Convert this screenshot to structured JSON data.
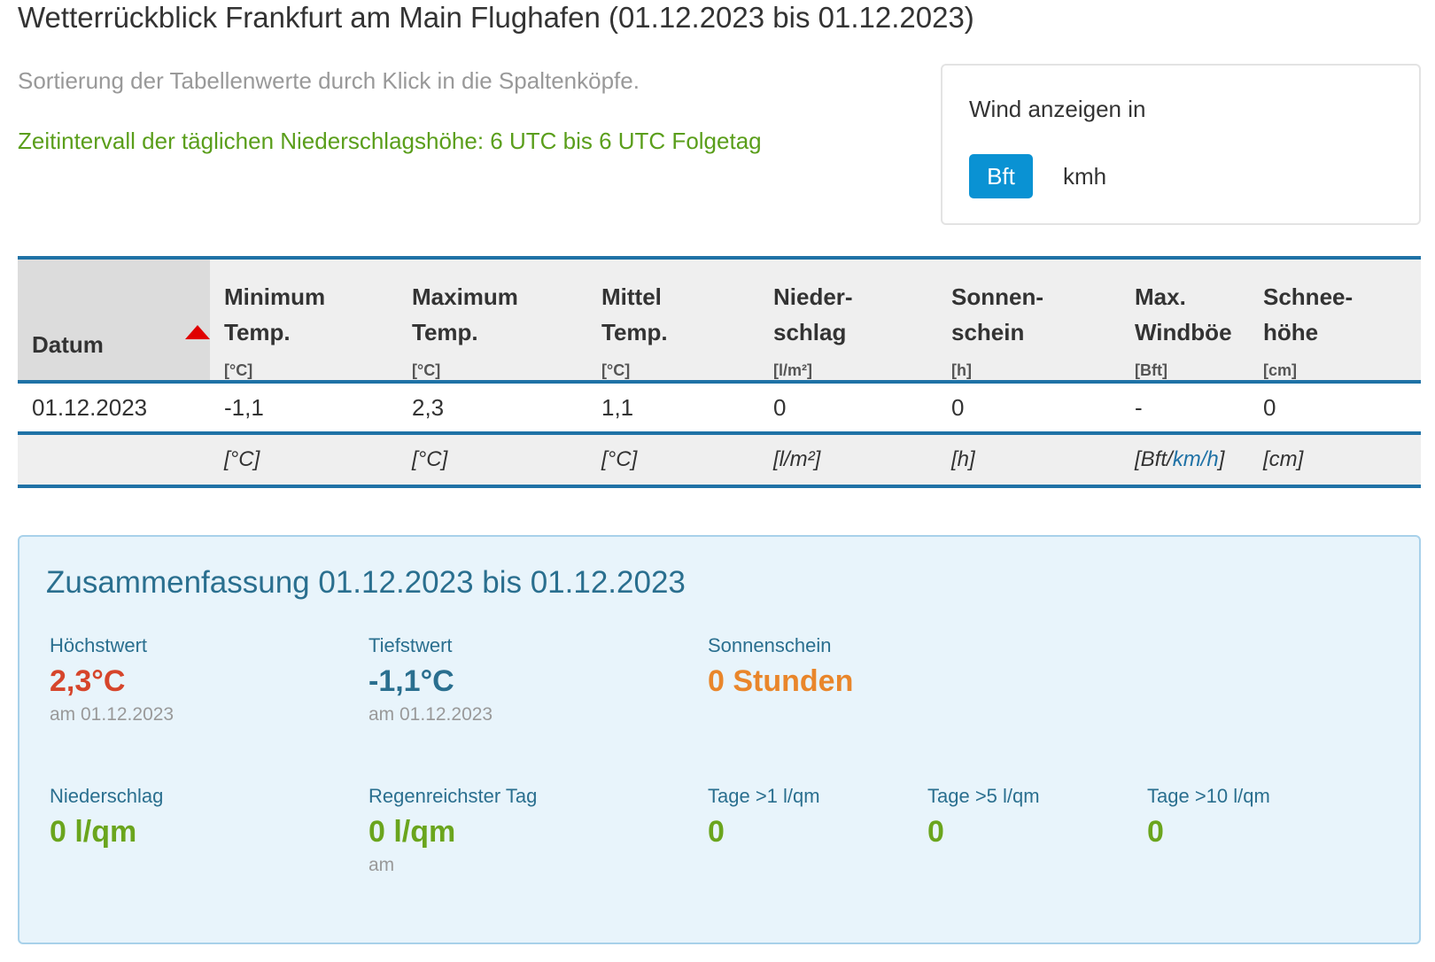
{
  "page": {
    "title": "Wetterrückblick Frankfurt am Main Flughafen (01.12.2023 bis 01.12.2023)",
    "sort_hint": "Sortierung der Tabellenwerte durch Klick in die Spaltenköpfe.",
    "interval_note": "Zeitintervall der täglichen Niederschlagshöhe: 6 UTC bis 6 UTC Folgetag"
  },
  "wind_toggle": {
    "label": "Wind anzeigen in",
    "options": [
      "Bft",
      "kmh"
    ],
    "selected": "Bft"
  },
  "table": {
    "columns": [
      {
        "name": "Datum",
        "unit": ""
      },
      {
        "name_line1": "Minimum",
        "name_line2": "Temp.",
        "unit": "[°C]"
      },
      {
        "name_line1": "Maximum",
        "name_line2": "Temp.",
        "unit": "[°C]"
      },
      {
        "name_line1": "Mittel",
        "name_line2": "Temp.",
        "unit": "[°C]"
      },
      {
        "name_line1": "Nieder-",
        "name_line2": "schlag",
        "unit": "[l/m²]"
      },
      {
        "name_line1": "Sonnen-",
        "name_line2": "schein",
        "unit": "[h]"
      },
      {
        "name_line1": "Max.",
        "name_line2": "Windböe",
        "unit": "[Bft]"
      },
      {
        "name_line1": "Schnee-",
        "name_line2": "höhe",
        "unit": "[cm]"
      }
    ],
    "rows": [
      [
        "01.12.2023",
        "-1,1",
        "2,3",
        "1,1",
        "0",
        "0",
        "-",
        "0"
      ]
    ],
    "footer_units": [
      "",
      "[°C]",
      "[°C]",
      "[°C]",
      "[l/m²]",
      "[h]",
      "",
      "[cm]"
    ],
    "footer_wind": {
      "pre": "[Bft/",
      "link": "km/h",
      "post": "]"
    }
  },
  "summary": {
    "title": "Zusammenfassung 01.12.2023 bis 01.12.2023",
    "hoechstwert": {
      "label": "Höchstwert",
      "value": "2,3°C",
      "sub": "am 01.12.2023"
    },
    "tiefstwert": {
      "label": "Tiefstwert",
      "value": "-1,1°C",
      "sub": "am 01.12.2023"
    },
    "sonnenschein": {
      "label": "Sonnenschein",
      "value": "0 Stunden"
    },
    "niederschlag": {
      "label": "Niederschlag",
      "value": "0 l/qm"
    },
    "regenreichster": {
      "label": "Regenreichster Tag",
      "value": "0 l/qm",
      "sub": "am"
    },
    "tage1": {
      "label": "Tage >1 l/qm",
      "value": "0"
    },
    "tage5": {
      "label": "Tage >5 l/qm",
      "value": "0"
    },
    "tage10": {
      "label": "Tage >10 l/qm",
      "value": "0"
    }
  },
  "colors": {
    "accent_blue": "#1f72a6",
    "button_blue": "#0a92d3",
    "green": "#6aa51d",
    "red": "#d6452b",
    "orange": "#e9862b"
  }
}
